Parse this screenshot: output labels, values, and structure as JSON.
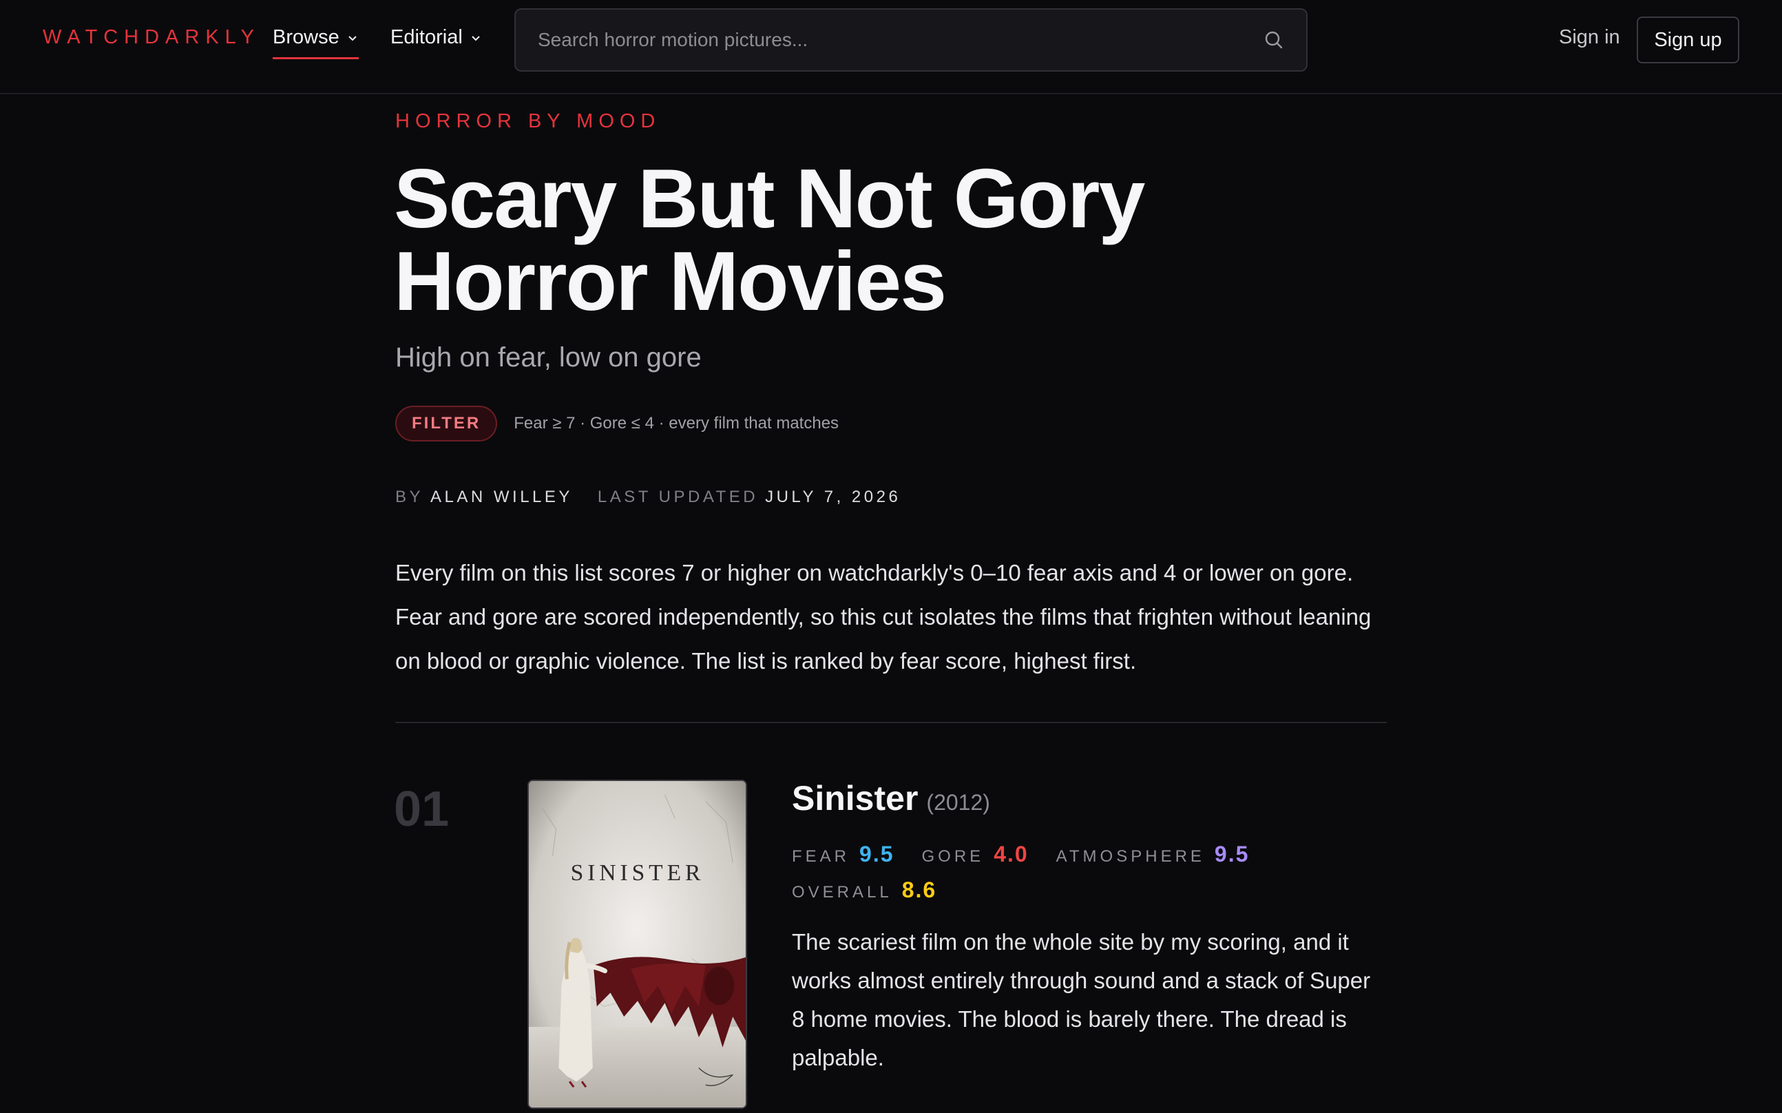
{
  "header": {
    "logo": "WATCHDARKLY",
    "nav": [
      {
        "label": "Browse"
      },
      {
        "label": "Editorial"
      }
    ],
    "search": {
      "placeholder": "Search horror motion pictures..."
    },
    "signin_label": "Sign in",
    "signup_label": "Sign up"
  },
  "page": {
    "eyebrow": "HORROR BY MOOD",
    "title": "Scary But Not Gory Horror Movies",
    "subtitle": "High on fear, low on gore",
    "filter_badge": "FILTER",
    "filter_text": "Fear ≥ 7 · Gore ≤ 4 · every film that matches",
    "byline": {
      "by_label": "BY",
      "author": "ALAN WILLEY",
      "updated_label": "LAST UPDATED",
      "date": "JULY 7, 2026"
    },
    "intro": "Every film on this list scores 7 or higher on watchdarkly's 0–10 fear axis and 4 or lower on gore. Fear and gore are scored independently, so this cut isolates the films that frighten without leaning on blood or graphic violence. The list is ranked by fear score, highest first."
  },
  "films": [
    {
      "rank": "01",
      "title": "Sinister",
      "year": "(2012)",
      "poster_text": "SINISTER",
      "scores": {
        "fear_label": "FEAR",
        "fear": "9.5",
        "gore_label": "GORE",
        "gore": "4.0",
        "atmosphere_label": "ATMOSPHERE",
        "atmosphere": "9.5",
        "overall_label": "OVERALL",
        "overall": "8.6"
      },
      "review": "The scariest film on the whole site by my scoring, and it works almost entirely through sound and a stack of Super 8 home movies. The blood is barely there. The dread is palpable."
    }
  ],
  "colors": {
    "accent": "#e5333c",
    "fear": "#3fb2f0",
    "gore": "#ef4444",
    "atmosphere": "#a78bfa",
    "overall": "#facc15"
  }
}
